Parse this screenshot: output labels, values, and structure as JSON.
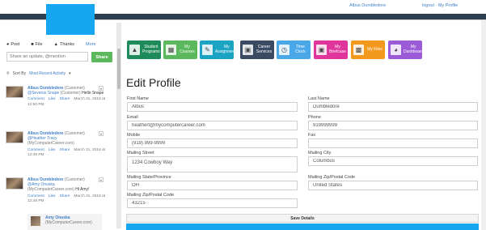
{
  "header": {
    "user_name": "Albus Dumbledore",
    "logout_label": "logout",
    "separator": " · ",
    "profile_label": "My Profile"
  },
  "composer": {
    "tabs": [
      {
        "label": "Post",
        "icon": "speech-bubble-icon"
      },
      {
        "label": "File",
        "icon": "file-icon"
      },
      {
        "label": "Thanks",
        "icon": "thumbs-up-icon"
      },
      {
        "label": "More",
        "icon": ""
      }
    ],
    "placeholder": "Share an update, @mention",
    "share_label": "Share"
  },
  "sort": {
    "label": "Sort By",
    "value": "Most Recent Activity"
  },
  "feed": [
    {
      "name": "Albus Dumbledore",
      "role": "(Customer)",
      "mention": "@Severus Snape",
      "mention_role": "(Customer)",
      "text": "Hello Snape",
      "actions": [
        "Comment",
        "Like",
        "Share"
      ],
      "date": "March 31, 2016 at 12:50 PM"
    },
    {
      "name": "Albus Dumbledore",
      "role": "(Customer)",
      "mention": "@Heather Tracy",
      "mention_role": "(MyComputerCareer.com)",
      "text": "",
      "actions": [
        "Comment",
        "Like",
        "Share"
      ],
      "date": "March 31, 2016 at 12:49 PM"
    },
    {
      "name": "Albus Dumbledore",
      "role": "(Customer)",
      "mention": "@Amy Onuska",
      "mention_role": "(MyComputerCareer.com)",
      "text": "Hi Amy!",
      "actions": [
        "Comment",
        "Like",
        "Share"
      ],
      "date": "March 31, 2016 at 12:48 PM"
    }
  ],
  "reply": {
    "name": "Amy Onuska",
    "role": "(MyComputerCareer.com)"
  },
  "tiles": [
    {
      "label": "Student Programs",
      "color": "#1f8a5a",
      "icon": "graduation-cap-icon"
    },
    {
      "label": "My Courses",
      "color": "#5cb85c",
      "icon": "book-icon"
    },
    {
      "label": "My Assignments",
      "color": "#1aa3c2",
      "icon": "pencil-icon"
    },
    {
      "label": "Career Services",
      "color": "#3a4a63",
      "icon": "briefcase-icon"
    },
    {
      "label": "Time Clock",
      "color": "#4aa8e8",
      "icon": "clock-icon"
    },
    {
      "label": "My Briefcase",
      "color": "#e0359a",
      "icon": "briefcase-icon"
    },
    {
      "label": "My Files",
      "color": "#f39a1e",
      "icon": "folder-icon"
    },
    {
      "label": "My Dashboard",
      "color": "#9b5bd6",
      "icon": "dashboard-icon"
    }
  ],
  "form": {
    "title": "Edit Profile",
    "first_name_label": "First Name",
    "first_name": "Albus",
    "last_name_label": "Last Name",
    "last_name": "Dumbledore",
    "email_label": "Email",
    "email": "heathert@mycomputercareer.com",
    "phone_label": "Phone",
    "phone": "919999999",
    "mobile_label": "Mobile",
    "mobile": "(919) 999-9999",
    "fax_label": "Fax",
    "fax": "",
    "street_label": "Mailing Street",
    "street": "1234 Cowboy Way",
    "city_label": "Mailing City",
    "city": "Columbus",
    "state_label": "Mailing State/Province",
    "state": "OH",
    "country_label": "Mailing Zip/Postal Code",
    "country": "United States",
    "zip_label": "Mailing Zip/Postal Code",
    "zip": "43215",
    "save_label": "Save Details"
  }
}
